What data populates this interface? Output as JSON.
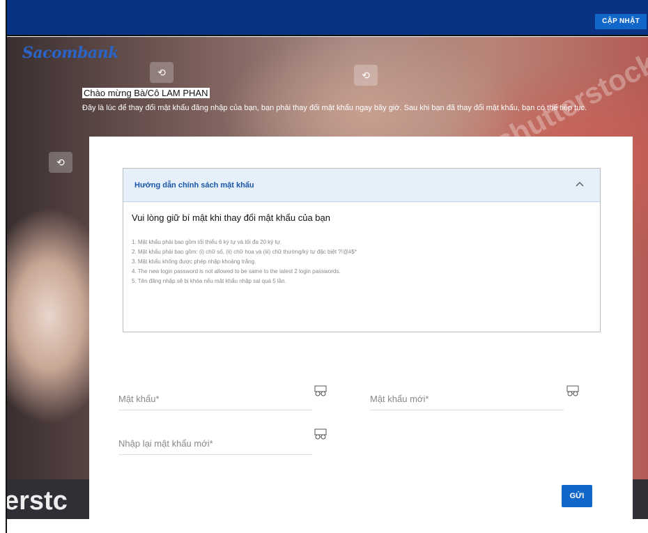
{
  "topbar": {
    "update_label": "CẬP NHẬT"
  },
  "brand": {
    "logo_text": "Sacombank"
  },
  "watermark": {
    "text": "shutterstock",
    "left_text": "erstc"
  },
  "welcome": {
    "title": "Chào mừng  Bà/Cô  LAM  PHAN",
    "description": "Đây là lúc để thay đổi mật khẩu đăng nhập của bạn, bạn phải thay đổi mật khẩu ngay bây giờ. Sau khi bạn đã thay đổi mật khẩu, bạn có thể tiếp tục."
  },
  "policy": {
    "heading": "Hướng dẫn chính sách mật khẩu",
    "subheading": "Vui lòng giữ bí mật khi thay đổi mật khẩu của bạn",
    "rules": [
      "1. Mật khẩu phải bao gồm tối thiểu 6 ký tự và tối đa 20 ký tự.",
      "2. Mật khẩu phải bao gồm: (i) chữ số, (ii) chữ hoa và (iii) chữ thường/ký tự đặc biệt ?!@#$*",
      "3. Mật khẩu không được phép nhập khoảng trắng.",
      "4. The new login password is not allowed to be same to the latest 2 login passwords.",
      "5. Tên đăng nhập sẽ bị khóa nếu mật khẩu nhập sai quá 5 lần."
    ]
  },
  "form": {
    "current_password": "Mật khẩu*",
    "new_password": "Mật khẩu mới*",
    "confirm_password": "Nhập lại mật khẩu mới*",
    "submit_label": "GỬI"
  },
  "colors": {
    "topbar": "#0a3282",
    "accent": "#1167c9",
    "policy_header": "#e5f0fb"
  }
}
